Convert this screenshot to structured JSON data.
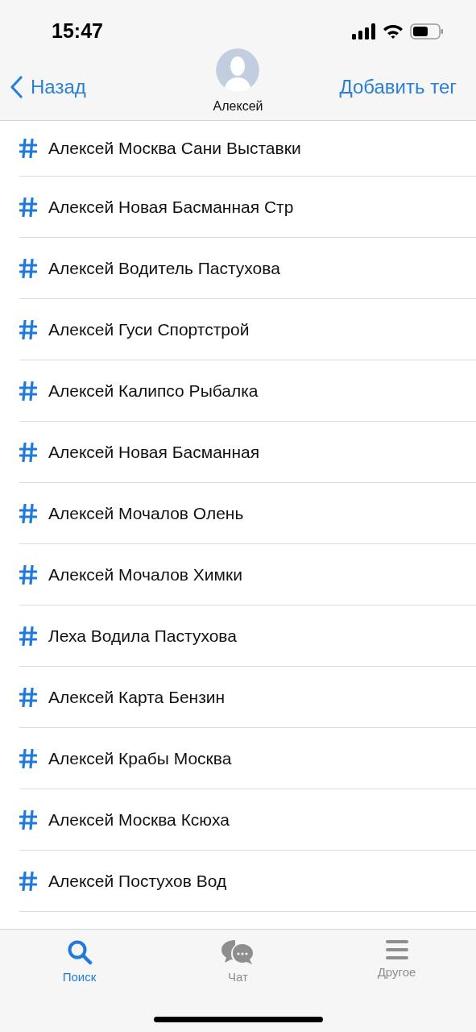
{
  "status_bar": {
    "time": "15:47"
  },
  "nav": {
    "back": "Назад",
    "contact": "Алексей",
    "action": "Добавить тег"
  },
  "tags": [
    {
      "label": "Алексей Москва Сани Выставки"
    },
    {
      "label": "Алексей Новая Басманная Стр"
    },
    {
      "label": "Алексей Водитель Пастухова"
    },
    {
      "label": "Алексей Гуси Спортстрой"
    },
    {
      "label": "Алексей Калипсо Рыбалка"
    },
    {
      "label": "Алексей Новая Басманная"
    },
    {
      "label": "Алексей Мочалов Олень"
    },
    {
      "label": "Алексей Мочалов Химки"
    },
    {
      "label": "Леха Водила Пастухова"
    },
    {
      "label": "Алексей Карта Бензин"
    },
    {
      "label": "Алексей Крабы Москва"
    },
    {
      "label": "Алексей Москва Ксюха"
    },
    {
      "label": "Алексей Постухов Вод"
    }
  ],
  "tab_bar": [
    {
      "kind": "search",
      "label": "Поиск",
      "selected": true
    },
    {
      "kind": "chat",
      "label": "Чат",
      "selected": false
    },
    {
      "kind": "menu",
      "label": "Другое",
      "selected": false
    }
  ]
}
